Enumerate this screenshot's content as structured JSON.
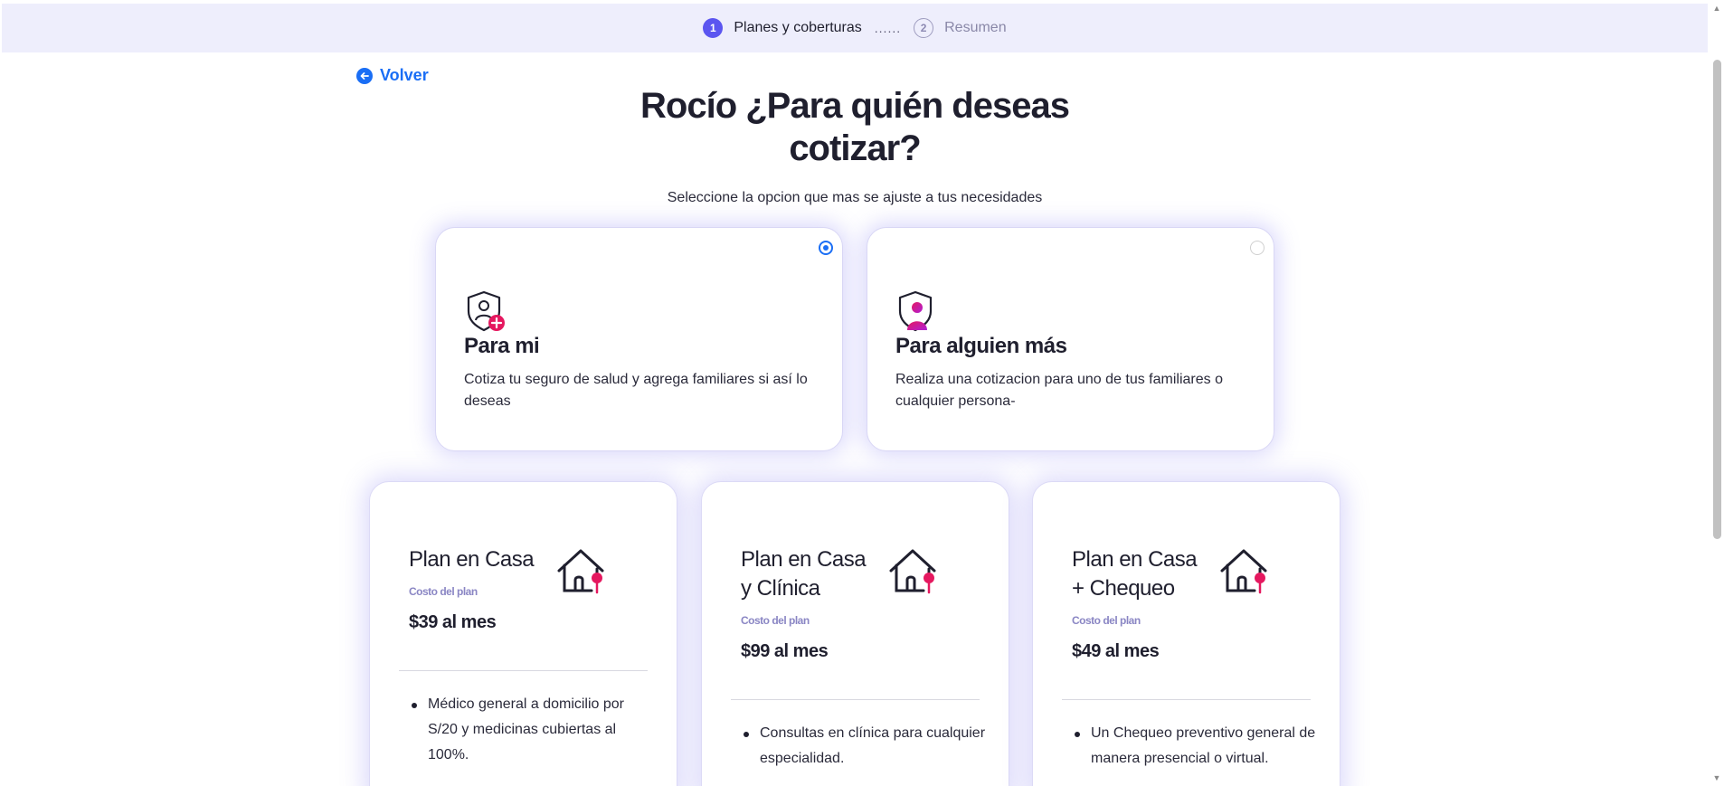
{
  "stepper": {
    "steps": [
      {
        "number": "1",
        "label": "Planes y coberturas"
      },
      {
        "number": "2",
        "label": "Resumen"
      }
    ],
    "separator": "......"
  },
  "back_link": {
    "label": "Volver"
  },
  "header": {
    "title_line1": "Rocío ¿Para quién deseas",
    "title_line2": "cotizar?",
    "subtitle": "Seleccione la opcion que mas se ajuste a tus necesidades"
  },
  "options": [
    {
      "title": "Para mi",
      "description": "Cotiza tu seguro de salud y agrega familiares si así lo deseas",
      "selected": true,
      "icon": "shield-user-plus-icon"
    },
    {
      "title": "Para alguien más",
      "description": "Realiza una cotizacion para uno de tus familiares o cualquier persona-",
      "selected": false,
      "icon": "shield-person-icon"
    }
  ],
  "plans": [
    {
      "name": "Plan en Casa",
      "cost_label": "Costo del plan",
      "price": "$39 al mes",
      "features": [
        "Médico general a domicilio por S/20 y medicinas cubiertas al 100%."
      ],
      "icon": "house-pin-icon"
    },
    {
      "name": "Plan en Casa y Clínica",
      "cost_label": "Costo del plan",
      "price": "$99 al mes",
      "features": [
        "Consultas en clínica para cualquier especialidad."
      ],
      "icon": "house-pin-icon"
    },
    {
      "name": "Plan en Casa + Chequeo",
      "cost_label": "Costo del plan",
      "price": "$49 al mes",
      "features": [
        "Un Chequeo preventivo general de manera presencial o virtual."
      ],
      "icon": "house-pin-icon"
    }
  ],
  "colors": {
    "accent": "#1a6ef5",
    "step_active": "#5b55f0",
    "stepper_bg": "#eeeefc",
    "pin": "#e5185f"
  }
}
